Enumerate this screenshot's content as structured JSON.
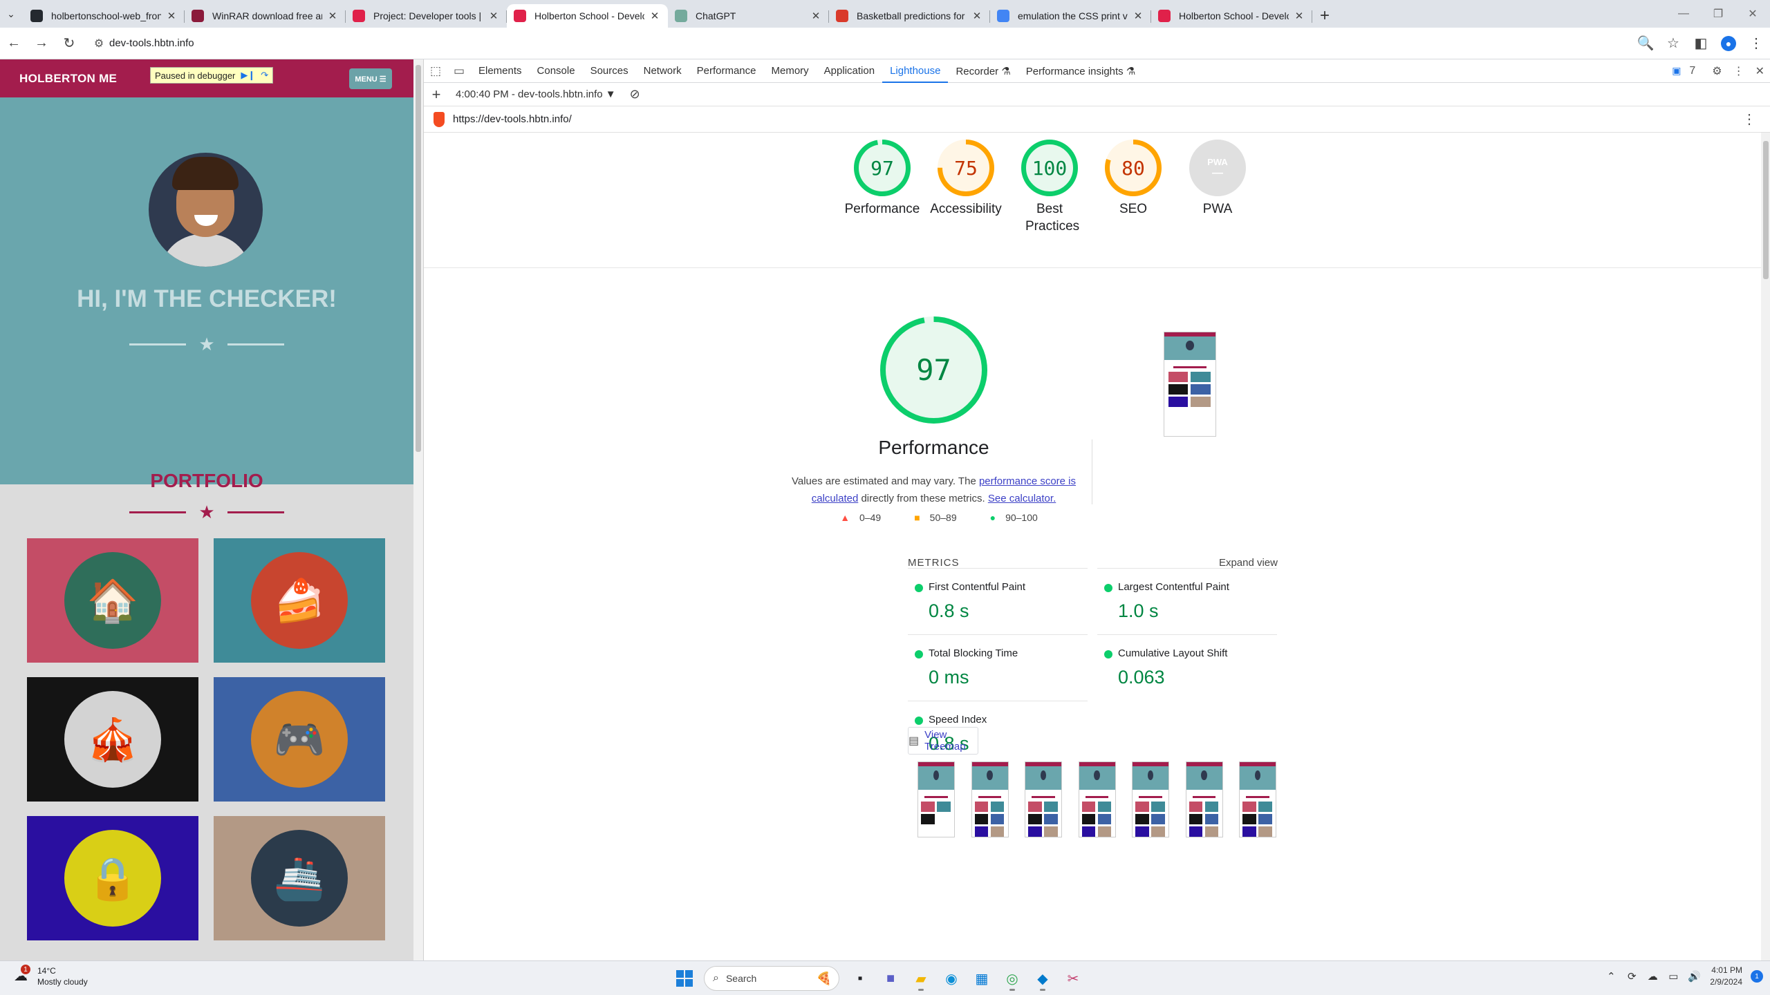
{
  "tabs": [
    {
      "title": "holbertonschool-web_front_en",
      "favicon": "github-icon",
      "color": "#24292f"
    },
    {
      "title": "WinRAR download free and su",
      "favicon": "winrar-icon",
      "color": "#8b1a3b"
    },
    {
      "title": "Project: Developer tools | Holb",
      "favicon": "holberton-icon",
      "color": "#e0214a"
    },
    {
      "title": "Holberton School - Developer t",
      "favicon": "holberton-icon",
      "color": "#e0214a",
      "active": true
    },
    {
      "title": "ChatGPT",
      "favicon": "chatgpt-icon",
      "color": "#74aa9c"
    },
    {
      "title": "Basketball predictions for Toda",
      "favicon": "basketball-icon",
      "color": "#d93a2b"
    },
    {
      "title": "emulation the CSS print version",
      "favicon": "google-icon",
      "color": "#4285f4"
    },
    {
      "title": "Holberton School - Developer t",
      "favicon": "holberton-icon",
      "color": "#e0214a"
    }
  ],
  "address": {
    "url": "dev-tools.hbtn.info"
  },
  "page": {
    "brand": "HOLBERTON ME",
    "debug_badge": "Paused in debugger",
    "menu_label": "MENU ☰",
    "hero_title": "HI, I'M THE CHECKER!",
    "portfolio_title": "PORTFOLIO",
    "portfolio": [
      {
        "name": "cabin",
        "bg": "#c44d66",
        "disc": "#2f6e5a",
        "glyph": "🏠"
      },
      {
        "name": "cake",
        "bg": "#3f8b98",
        "disc": "#c8452f",
        "glyph": "🍰"
      },
      {
        "name": "circus",
        "bg": "#141414",
        "disc": "#d3d3d3",
        "glyph": "🎪"
      },
      {
        "name": "game",
        "bg": "#3c62a5",
        "disc": "#d0822b",
        "glyph": "🎮"
      },
      {
        "name": "safe",
        "bg": "#2a0fa0",
        "disc": "#d9cf16",
        "glyph": "🔒"
      },
      {
        "name": "submarine",
        "bg": "#b39985",
        "disc": "#2b3b4b",
        "glyph": "🚢"
      }
    ]
  },
  "devtools": {
    "tabs": [
      "Elements",
      "Console",
      "Sources",
      "Network",
      "Performance",
      "Memory",
      "Application",
      "Lighthouse",
      "Recorder ⚗",
      "Performance insights ⚗"
    ],
    "active_tab": "Lighthouse",
    "issues_count": "7",
    "report_label": "4:00:40 PM - dev-tools.hbtn.info",
    "report_url": "https://dev-tools.hbtn.info/"
  },
  "lighthouse": {
    "scores": [
      {
        "label": "Performance",
        "value": 97,
        "color": "#0cce6b",
        "text": "#018642",
        "bg": "#e8f8ee"
      },
      {
        "label": "Accessibility",
        "value": 75,
        "color": "#ffa400",
        "text": "#c33300",
        "bg": "#fff6e6"
      },
      {
        "label": "Best Practices",
        "value": 100,
        "color": "#0cce6b",
        "text": "#018642",
        "bg": "#e8f8ee"
      },
      {
        "label": "SEO",
        "value": 80,
        "color": "#ffa400",
        "text": "#c33300",
        "bg": "#fff6e6"
      },
      {
        "label": "PWA",
        "value": null,
        "color": "#cccccc",
        "text": "#999999",
        "bg": "#e0e0e0"
      }
    ],
    "pwa_badge": "PWA",
    "perf_score": 97,
    "perf_title": "Performance",
    "note_prefix": "Values are estimated and may vary. The ",
    "note_link1": "performance score is calculated",
    "note_middle": " directly from these metrics. ",
    "note_link2": "See calculator.",
    "legend": [
      {
        "symbol": "▲",
        "color": "#ff4e42",
        "range": "0–49"
      },
      {
        "symbol": "■",
        "color": "#ffa400",
        "range": "50–89"
      },
      {
        "symbol": "●",
        "color": "#0cce6b",
        "range": "90–100"
      }
    ],
    "metrics_header": "METRICS",
    "expand_label": "Expand view",
    "metrics": [
      {
        "name": "First Contentful Paint",
        "value": "0.8 s"
      },
      {
        "name": "Largest Contentful Paint",
        "value": "1.0 s"
      },
      {
        "name": "Total Blocking Time",
        "value": "0 ms"
      },
      {
        "name": "Cumulative Layout Shift",
        "value": "0.063"
      },
      {
        "name": "Speed Index",
        "value": "0.8 s"
      }
    ],
    "treemap_label": "View Treemap"
  },
  "taskbar": {
    "temp": "14°C",
    "weather": "Mostly cloudy",
    "weather_badge": "1",
    "search_placeholder": "Search",
    "time": "4:01 PM",
    "date": "2/9/2024",
    "notif_count": "1"
  }
}
